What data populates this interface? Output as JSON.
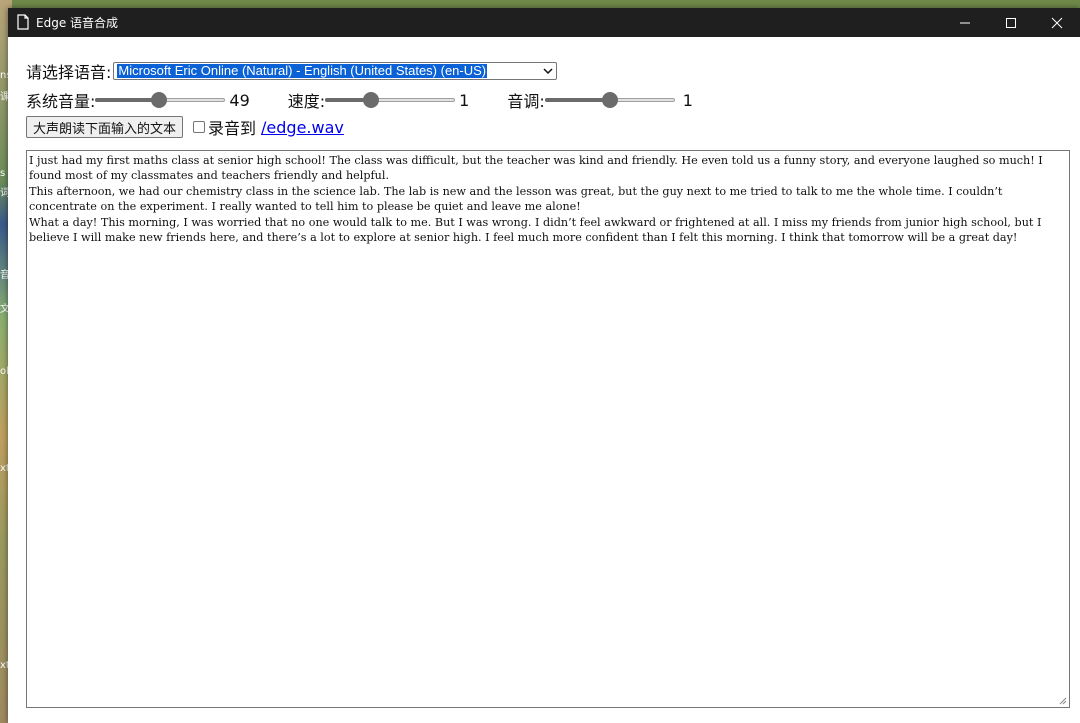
{
  "desktop": {
    "labels": [
      "ns",
      "课",
      "s i",
      "词",
      "音",
      "文",
      "ol",
      "xt",
      "xt"
    ]
  },
  "window": {
    "title": "Edge 语音合成"
  },
  "controls": {
    "voice_label": "请选择语音:",
    "voice_selected": "Microsoft Eric Online (Natural) - English (United States) (en-US)",
    "volume_label": "系统音量:",
    "volume_value": "49",
    "volume_level": 0.49,
    "speed_label": "速度:",
    "speed_value": "1",
    "speed_level": 0.35,
    "pitch_label": "音调:",
    "pitch_value": "1",
    "pitch_level": 0.5,
    "speak_button": "大声朗读下面输入的文本",
    "record_checked": false,
    "record_label": "录音到",
    "record_link": "/edge.wav"
  },
  "text_input": {
    "lines": [
      "I just had my first maths class at senior high school! The class was difficult, but the teacher was kind and friendly. He even told us a funny story, and everyone laughed so much! I found most of my classmates and teachers friendly and helpful.",
      "This afternoon, we had our chemistry class in the science lab. The lab is new and the lesson was great, but the guy next to me tried to talk to me the whole time. I couldn’t concentrate on the experiment. I really wanted to tell him to please be quiet and leave me alone!",
      "What a day! This morning, I was worried that no one would talk to me. But I was wrong. I didn’t feel awkward or frightened at all. I miss my friends from junior high school, but I believe I will make new friends here, and there’s a lot to explore at senior high. I feel much more confident than I felt this morning. I think that tomorrow will be a great day!"
    ]
  }
}
